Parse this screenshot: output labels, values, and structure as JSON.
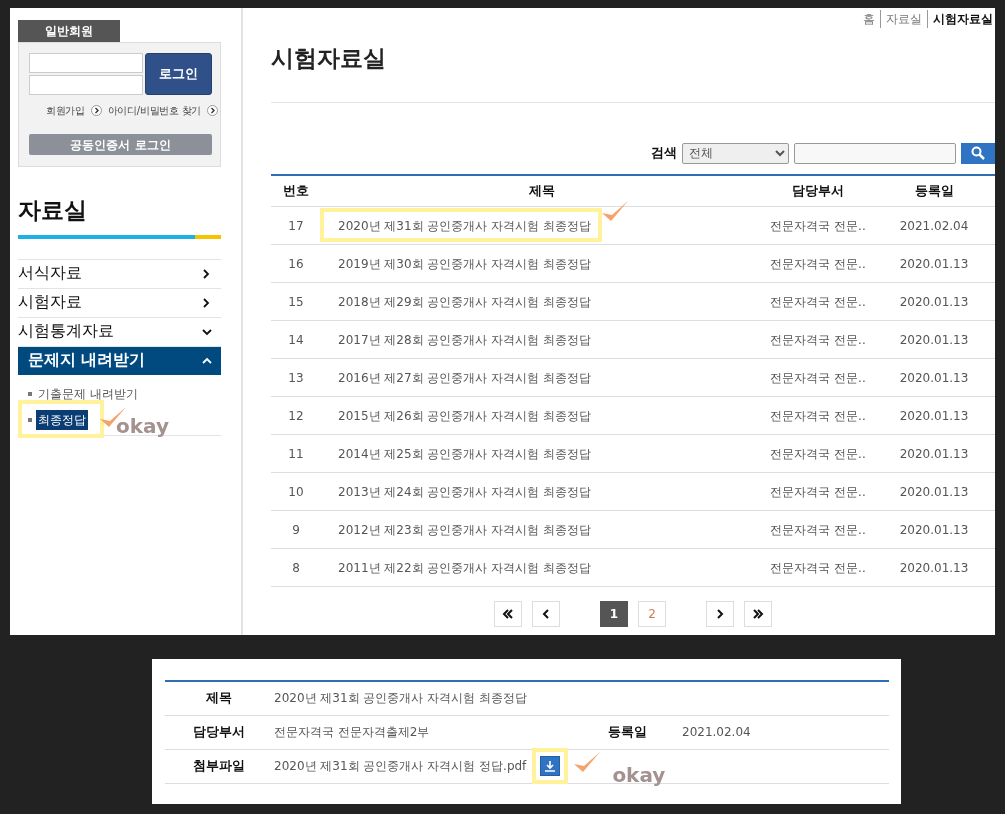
{
  "login": {
    "tab": "일반회원",
    "button": "로그인",
    "links": [
      "회원가입",
      "아이디/비밀번호 찾기"
    ],
    "cert_button": "공동인증서 로그인"
  },
  "sidebar": {
    "title": "자료실",
    "items": [
      {
        "label": "서식자료",
        "kind": "link",
        "selected": false
      },
      {
        "label": "시험자료",
        "kind": "link",
        "selected": false
      },
      {
        "label": "시험통계자료",
        "kind": "group",
        "selected": false,
        "expanded": false
      },
      {
        "label": "문제지 내려받기",
        "kind": "group",
        "selected": true,
        "expanded": true,
        "children": [
          {
            "label": "기출문제 내려받기",
            "selected": false,
            "highlighted": false
          },
          {
            "label": "최종정답",
            "selected": true,
            "highlighted": true,
            "note": "okay"
          }
        ]
      }
    ]
  },
  "breadcrumb": [
    "홈",
    "자료실",
    "시험자료실"
  ],
  "page_title": "시험자료실",
  "search": {
    "label": "검색",
    "scope": "전체"
  },
  "table": {
    "columns": [
      "번호",
      "제목",
      "담당부서",
      "등록일"
    ],
    "rows": [
      {
        "no": "17",
        "title": "2020년 제31회 공인중개사 자격시험 최종정답",
        "dept": "전문자격국 전문..",
        "date": "2021.02.04",
        "highlighted": true
      },
      {
        "no": "16",
        "title": "2019년 제30회 공인중개사 자격시험 최종정답",
        "dept": "전문자격국 전문..",
        "date": "2020.01.13",
        "highlighted": false
      },
      {
        "no": "15",
        "title": "2018년 제29회 공인중개사 자격시험 최종정답",
        "dept": "전문자격국 전문..",
        "date": "2020.01.13",
        "highlighted": false
      },
      {
        "no": "14",
        "title": "2017년 제28회 공인중개사 자격시험 최종정답",
        "dept": "전문자격국 전문..",
        "date": "2020.01.13",
        "highlighted": false
      },
      {
        "no": "13",
        "title": "2016년 제27회 공인중개사 자격시험 최종정답",
        "dept": "전문자격국 전문..",
        "date": "2020.01.13",
        "highlighted": false
      },
      {
        "no": "12",
        "title": "2015년 제26회 공인중개사 자격시험 최종정답",
        "dept": "전문자격국 전문..",
        "date": "2020.01.13",
        "highlighted": false
      },
      {
        "no": "11",
        "title": "2014년 제25회 공인중개사 자격시험 최종정답",
        "dept": "전문자격국 전문..",
        "date": "2020.01.13",
        "highlighted": false
      },
      {
        "no": "10",
        "title": "2013년 제24회 공인중개사 자격시험 최종정답",
        "dept": "전문자격국 전문..",
        "date": "2020.01.13",
        "highlighted": false
      },
      {
        "no": "9",
        "title": "2012년 제23회 공인중개사 자격시험 최종정답",
        "dept": "전문자격국 전문..",
        "date": "2020.01.13",
        "highlighted": false
      },
      {
        "no": "8",
        "title": "2011년 제22회 공인중개사 자격시험 최종정답",
        "dept": "전문자격국 전문..",
        "date": "2020.01.13",
        "highlighted": false
      }
    ]
  },
  "pagination": {
    "pages": [
      {
        "label": "1",
        "selected": true
      },
      {
        "label": "2",
        "selected": false
      }
    ]
  },
  "detail": {
    "title_label": "제목",
    "title": "2020년 제31회 공인중개사 자격시험 최종정답",
    "dept_label": "담당부서",
    "dept": "전문자격국 전문자격출제2부",
    "date_label": "등록일",
    "date": "2021.02.04",
    "file_label": "첨부파일",
    "file": "2020년 제31회 공인중개사 자격시험 정답.pdf",
    "highlighted": true,
    "note": "okay"
  }
}
